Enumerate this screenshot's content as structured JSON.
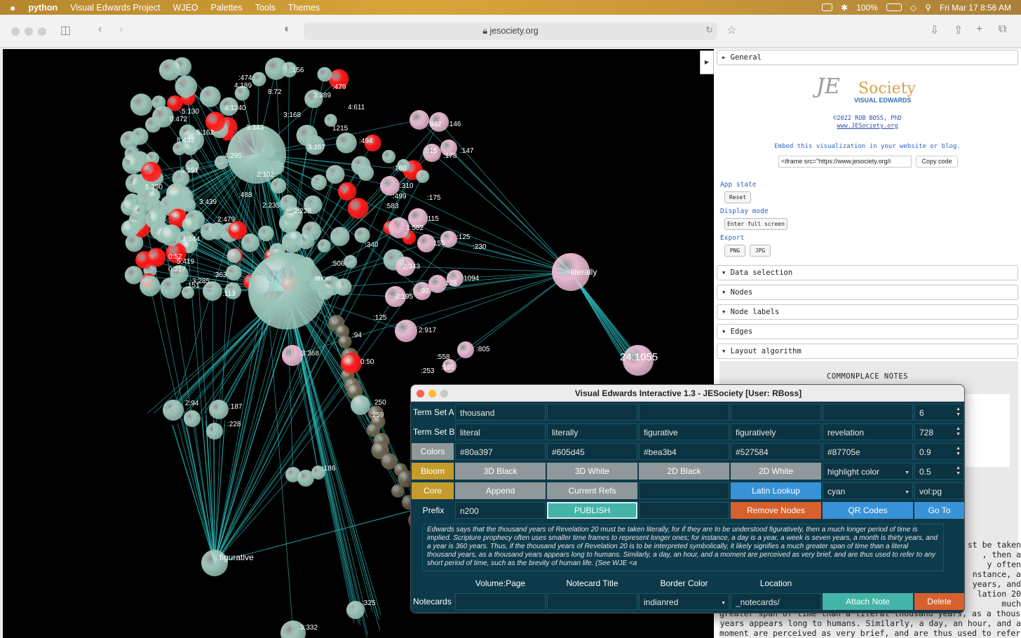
{
  "menubar": {
    "app": "python",
    "items": [
      "Visual Edwards Project",
      "WJEO",
      "Palettes",
      "Tools",
      "Themes"
    ],
    "battery": "100%",
    "clock": "Fri Mar 17  8:56 AM"
  },
  "browser": {
    "url": "jesociety.org"
  },
  "viz": {
    "labels": [
      {
        "t": ":156",
        "c": "w"
      },
      {
        "t": ":474",
        "c": "w"
      },
      {
        "t": "4:189",
        "c": "w"
      },
      {
        "t": ":479",
        "c": "w"
      },
      {
        "t": "3:389",
        "c": "w"
      },
      {
        "t": "8:72",
        "c": "w"
      },
      {
        "t": "5:130",
        "c": "w"
      },
      {
        "t": "4:1240",
        "c": "w"
      },
      {
        "t": "3:168",
        "c": "w"
      },
      {
        "t": "4:611",
        "c": "w"
      },
      {
        "t": "0:472",
        "c": "w"
      },
      {
        "t": "3:343",
        "c": "w"
      },
      {
        "t": "5:162",
        "c": "w"
      },
      {
        "t": "1215",
        "c": "w"
      },
      {
        "t": ":842",
        "c": "w"
      },
      {
        "t": ":146",
        "c": "w"
      },
      {
        "t": "8:433",
        "c": "w"
      },
      {
        "t": "4:295",
        "c": "w"
      },
      {
        "t": "3:167",
        "c": "w"
      },
      {
        "t": ":494",
        "c": "w"
      },
      {
        "t": ":815",
        "c": "w"
      },
      {
        "t": ":147",
        "c": "w"
      },
      {
        "t": ":178",
        "c": "w"
      },
      {
        "t": "5:191",
        "c": "w"
      },
      {
        "t": "2:102",
        "c": "w"
      },
      {
        "t": ":160",
        "c": "w"
      },
      {
        "t": "5:390",
        "c": "w"
      },
      {
        "t": ":488",
        "c": "w"
      },
      {
        "t": ":310",
        "c": "w"
      },
      {
        "t": ":175",
        "c": "w"
      },
      {
        "t": "3:439",
        "c": "w"
      },
      {
        "t": "2:235",
        "c": "w"
      },
      {
        "t": "2:228",
        "c": "w"
      },
      {
        "t": ":499",
        "c": "w"
      },
      {
        "t": ":583",
        "c": "w"
      },
      {
        "t": ":115",
        "c": "w"
      },
      {
        "t": "2:479",
        "c": "w"
      },
      {
        "t": "1:502",
        "c": "w"
      },
      {
        "t": ":125",
        "c": "w"
      },
      {
        "t": ":155",
        "c": "w"
      },
      {
        "t": ":230",
        "c": "w"
      },
      {
        "t": ":340",
        "c": "w"
      },
      {
        "t": "1:244",
        "c": "w"
      },
      {
        "t": "0:52",
        "c": "w"
      },
      {
        "t": "5:419",
        "c": "w"
      },
      {
        "t": "0:317",
        "c": "w"
      },
      {
        "t": ":363",
        "c": "w"
      },
      {
        "t": ":506",
        "c": "w"
      },
      {
        "t": "literally",
        "c": "w"
      },
      {
        "t": "2:343",
        "c": "w"
      },
      {
        "t": "1094",
        "c": "w"
      },
      {
        "t": ":128",
        "c": "w"
      },
      {
        "t": ":93",
        "c": "w"
      },
      {
        "t": "3:285",
        "c": "w"
      },
      {
        "t": ":151",
        "c": "w"
      },
      {
        "t": ":113",
        "c": "w"
      },
      {
        "t": "ation",
        "c": "w"
      },
      {
        "t": "2:195",
        "c": "w"
      },
      {
        "t": ":125",
        "c": "w"
      },
      {
        "t": "2:917",
        "c": "w"
      },
      {
        "t": ":94",
        "c": "w"
      },
      {
        "t": "3:368",
        "c": "w"
      },
      {
        "t": ":805",
        "c": "w"
      },
      {
        "t": "24:1055",
        "c": "w"
      },
      {
        "t": "0:50",
        "c": "w"
      },
      {
        "t": ":558",
        "c": "w"
      },
      {
        "t": ":151",
        "c": "w"
      },
      {
        "t": ":253",
        "c": "w"
      },
      {
        "t": "250",
        "c": "w"
      },
      {
        "t": ":259",
        "c": "w"
      },
      {
        "t": "2:94",
        "c": "w"
      },
      {
        "t": ":187",
        "c": "w"
      },
      {
        "t": ":228",
        "c": "w"
      },
      {
        "t": ":186",
        "c": "w"
      },
      {
        "t": "figurative",
        "c": "w"
      },
      {
        "t": ":325",
        "c": "w"
      },
      {
        "t": "3:332",
        "c": "w"
      }
    ]
  },
  "panel": {
    "general": "General",
    "logo_a": "JE",
    "logo_b": "Society",
    "logo_c": "VISUAL EDWARDS",
    "copyright": "©2022 ROB BOSS, PhD",
    "site": "www.JESociety.org",
    "embed": "Embed this visualization in your website or blog.",
    "iframe_code": "<iframe src=\"https://www.jesociety.org/i",
    "copy_code": "Copy code",
    "app_state": "App state",
    "reset": "Reset",
    "display_mode": "Display mode",
    "fullscreen": "Enter full screen",
    "export": "Export",
    "png": "PNG",
    "jpg": "JPG",
    "sections": [
      "Data selection",
      "Nodes",
      "Node labels",
      "Edges",
      "Layout algorithm"
    ],
    "commonplace": "COMMONPLACE NOTES",
    "notes_text": "st be taken\n, then a\ny often\nnstance, a\nyears, and\nlation 20\nmuch\ngreater span of time than a literal thousand years, as a thousand\nyears appears long to humans. Similarly, a day, an hour, and a\nmoment are perceived as very brief, and are thus used to refer to"
  },
  "app": {
    "title": "Visual Edwards Interactive 1.3 - JESociety [User: RBoss]",
    "term_a_label": "Term Set A",
    "term_a": [
      "thousand",
      "",
      "",
      "",
      ""
    ],
    "term_a_num": "6",
    "term_b_label": "Term Set B",
    "term_b": [
      "literal",
      "literally",
      "figurative",
      "figuratively",
      "revelation"
    ],
    "term_b_num": "728",
    "colors_label": "Colors",
    "colors": [
      "#80a397",
      "#605d45",
      "#bea3b4",
      "#527584",
      "#87705e"
    ],
    "colors_num": "0.9",
    "bloom": "Bloom",
    "b3dblack": "3D Black",
    "b3dwhite": "3D White",
    "b2dblack": "2D Black",
    "b2dwhite": "2D White",
    "highlight": "highlight color",
    "bloom_num": "0.5",
    "core": "Core",
    "append": "Append",
    "current_refs": "Current Refs",
    "latin": "Latin Lookup",
    "cyan": "cyan",
    "volpg": "vol:pg",
    "prefix_label": "Prefix",
    "prefix": "n200",
    "publish": "PUBLISH",
    "remove": "Remove Nodes",
    "qr": "QR Codes",
    "goto": "Go To",
    "note": "Edwards says that the thousand years of Revelation 20 must be taken literally, for if they are to be understood figuratively, then a much longer period of time is implied. Scripture prophecy often uses smaller time frames to represent longer ones; for instance, a day is a year, a week is seven years, a month is thirty years, and a year is 360 years. Thus, if the thousand years of Revelation 20 is to be interpreted symbolically, it likely signifies a much greater span of time than a literal thousand years, as a thousand years appears long to humans. Similarly, a day, an hour, and a moment are perceived as very brief, and are thus used to refer to any short period of time, such as the brevity of human life. (See WJE <a",
    "h_volpage": "Volume:Page",
    "h_title": "Notecard Title",
    "h_border": "Border Color",
    "h_location": "Location",
    "notecards": "Notecards",
    "border_color": "indianred",
    "location": "_notecards/",
    "attach": "Attach Note",
    "delete": "Delete"
  },
  "colors": {
    "teal_node": "#9bc4b8",
    "red_node": "#ff1a1a",
    "pink_node": "#e6b8cf",
    "brown_node": "#6e6550",
    "edge": "#2ec4c4"
  }
}
